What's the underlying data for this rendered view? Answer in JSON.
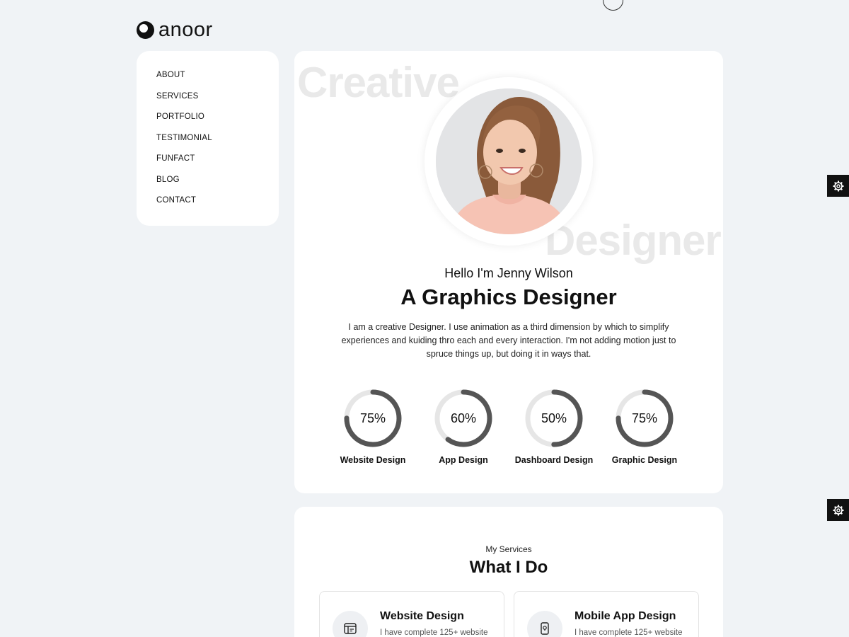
{
  "brand": {
    "name": "anoor"
  },
  "nav": {
    "items": [
      {
        "label": "ABOUT"
      },
      {
        "label": "SERVICES"
      },
      {
        "label": "PORTFOLIO"
      },
      {
        "label": "TESTIMONIAL"
      },
      {
        "label": "FUNFACT"
      },
      {
        "label": "BLOG"
      },
      {
        "label": "CONTACT"
      }
    ]
  },
  "hero": {
    "bg_word_1": "Creative",
    "bg_word_2": "Designer",
    "greeting": "Hello I'm Jenny Wilson",
    "role": "A Graphics Designer",
    "bio": "I am a creative Designer. I use animation as a third dimension by which to simplify experiences and kuiding thro each and every interaction. I'm not adding motion just to spruce things up, but doing it in ways that.",
    "skills": [
      {
        "label": "Website Design",
        "percent_text": "75%",
        "value": 75
      },
      {
        "label": "App Design",
        "percent_text": "60%",
        "value": 60
      },
      {
        "label": "Dashboard Design",
        "percent_text": "50%",
        "value": 50
      },
      {
        "label": "Graphic Design",
        "percent_text": "75%",
        "value": 75
      }
    ]
  },
  "services": {
    "subtitle": "My Services",
    "title": "What I Do",
    "cards": [
      {
        "name": "Website Design",
        "desc": "I have complete 125+ website",
        "icon": "browser-icon"
      },
      {
        "name": "Mobile App Design",
        "desc": "I have complete 125+ website",
        "icon": "mobile-icon"
      }
    ]
  },
  "colors": {
    "background": "#f0f3f6",
    "panel": "#ffffff",
    "progress_fill": "#555555",
    "progress_track": "#e6e6e6",
    "settings_button": "#111111"
  },
  "icons": {
    "settings": "gear-icon"
  }
}
